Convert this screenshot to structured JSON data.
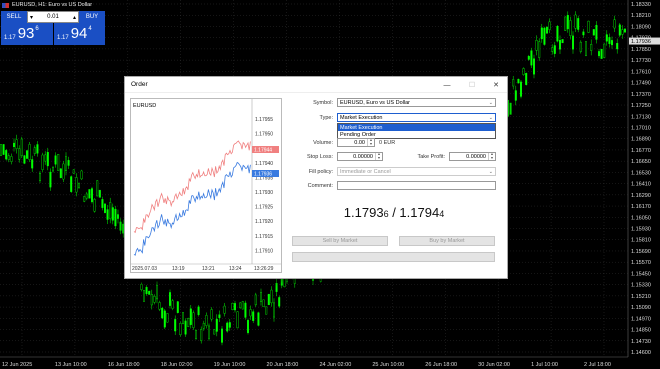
{
  "window": {
    "symbol_title": "EURUSD, H1:  Euro vs US Dollar",
    "flag_icon": "eu-us-flag-icon"
  },
  "one_click": {
    "sell_label": "SELL",
    "buy_label": "BUY",
    "volume": "0.01",
    "volume_down": "▾",
    "volume_up": "▴",
    "sell_prefix": "1.17",
    "sell_big": "93",
    "sell_sup": "6",
    "buy_prefix": "1.17",
    "buy_big": "94",
    "buy_sup": "4",
    "button_color": "#1a4fc4"
  },
  "price_axis": {
    "labels": [
      "1.18330",
      "1.18210",
      "1.18090",
      "1.17970",
      "1.17850",
      "1.17730",
      "1.17610",
      "1.17490",
      "1.17370",
      "1.17250",
      "1.17130",
      "1.17010",
      "1.16890",
      "1.16770",
      "1.16650",
      "1.16530",
      "1.16410",
      "1.16290",
      "1.16170",
      "1.16050",
      "1.15930",
      "1.15810",
      "1.15690",
      "1.15570",
      "1.15450",
      "1.15330",
      "1.15210",
      "1.15090",
      "1.14970",
      "1.14850",
      "1.14730",
      "1.14600"
    ],
    "current_label": "1.17936"
  },
  "time_axis": {
    "labels": [
      "12 Jun 2025",
      "13 Jun 10:00",
      "16 Jun 18:00",
      "18 Jun 02:00",
      "19 Jun 10:00",
      "20 Jun 18:00",
      "24 Jun 02:00",
      "25 Jun 10:00",
      "26 Jun 18:00",
      "30 Jun 02:00",
      "1 Jul 10:00",
      "2 Jul 18:00"
    ]
  },
  "dialog": {
    "title": "Order",
    "minimize": "—",
    "maximize": "☐",
    "close": "✕",
    "mini_chart": {
      "symbol": "EURUSD",
      "y_labels": [
        "1.17955",
        "1.17950",
        "1.17945",
        "1.17940",
        "1.17935",
        "1.17930",
        "1.17925",
        "1.17920",
        "1.17915",
        "1.17910"
      ],
      "x_labels": [
        "2025.07.03",
        "13:19",
        "13:21",
        "13:24",
        "13:26:29"
      ],
      "ask_label": "1.17944",
      "bid_label": "1.17936",
      "ask_color": "#f08080",
      "bid_color": "#3a7be0"
    },
    "form": {
      "symbol_label": "Symbol:",
      "symbol_value": "EURUSD, Euro vs US Dollar",
      "type_label": "Type:",
      "type_value": "Market Execution",
      "type_options": [
        "Market Execution",
        "Pending Order"
      ],
      "volume_label": "Volume:",
      "volume_value": "0.00",
      "volume_unit": "0 EUR",
      "stop_loss_label": "Stop Loss:",
      "stop_loss_value": "0.00000",
      "take_profit_label": "Take Profit:",
      "take_profit_value": "0.00000",
      "fill_policy_label": "Fill policy:",
      "fill_policy_value": "Immediate or Cancel",
      "comment_label": "Comment:",
      "comment_value": "",
      "bid_main": "1.1793",
      "bid_sub": "6",
      "separator": " / ",
      "ask_main": "1.1794",
      "ask_sub": "4",
      "sell_button": "Sell by Market",
      "buy_button": "Buy by Market",
      "bottom_button": ""
    }
  },
  "colors": {
    "candle_up": "#00ff00",
    "candle_down": "#00ff00",
    "grid": "#2a2a2a",
    "selection": "#1e5ecf"
  }
}
